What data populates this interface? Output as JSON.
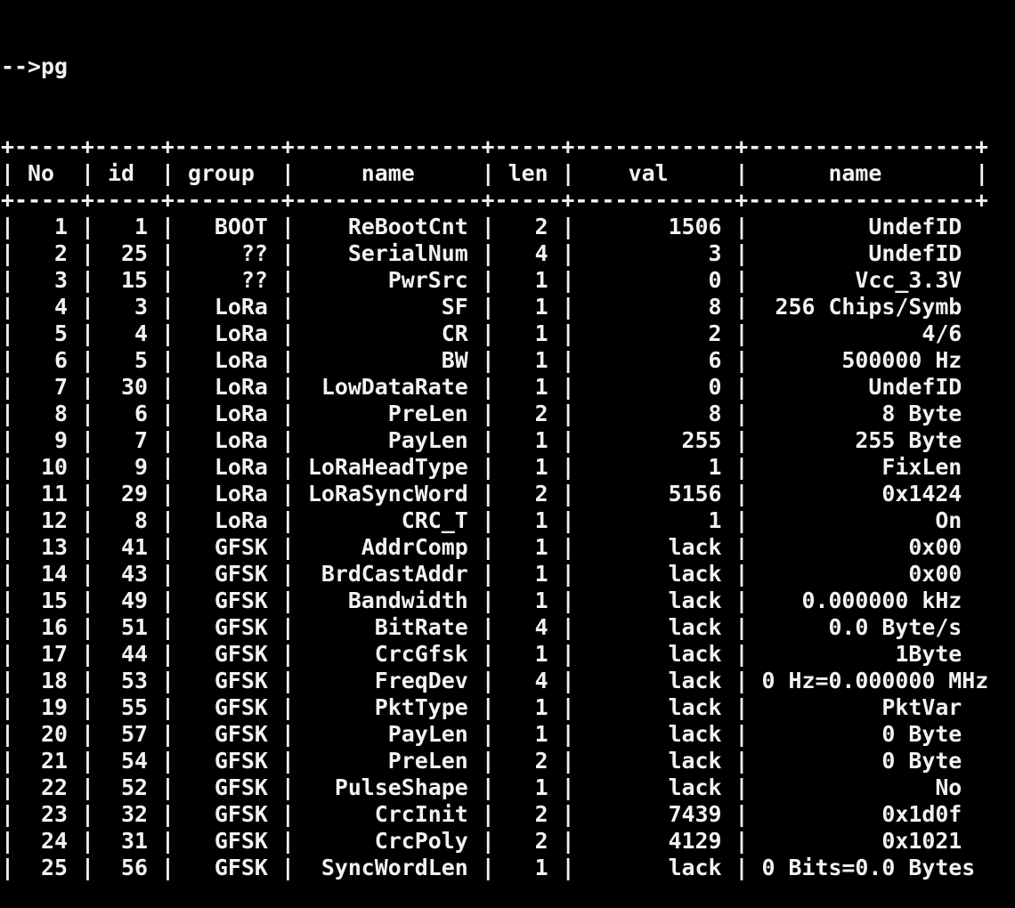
{
  "terminal": {
    "prompt": "-->",
    "command": "pg",
    "background": "#000000",
    "foreground": "#f2f2f2"
  },
  "table": {
    "columns": [
      "No",
      "id",
      "group",
      "name",
      "len",
      "val",
      "name"
    ],
    "rows": [
      [
        "1",
        "1",
        "BOOT",
        "ReBootCnt",
        "2",
        "1506",
        "UndefID"
      ],
      [
        "2",
        "25",
        "??",
        "SerialNum",
        "4",
        "3",
        "UndefID"
      ],
      [
        "3",
        "15",
        "??",
        "PwrSrc",
        "1",
        "0",
        "Vcc_3.3V"
      ],
      [
        "4",
        "3",
        "LoRa",
        "SF",
        "1",
        "8",
        "256 Chips/Symb"
      ],
      [
        "5",
        "4",
        "LoRa",
        "CR",
        "1",
        "2",
        "4/6"
      ],
      [
        "6",
        "5",
        "LoRa",
        "BW",
        "1",
        "6",
        "500000 Hz"
      ],
      [
        "7",
        "30",
        "LoRa",
        "LowDataRate",
        "1",
        "0",
        "UndefID"
      ],
      [
        "8",
        "6",
        "LoRa",
        "PreLen",
        "2",
        "8",
        "8 Byte"
      ],
      [
        "9",
        "7",
        "LoRa",
        "PayLen",
        "1",
        "255",
        "255 Byte"
      ],
      [
        "10",
        "9",
        "LoRa",
        "LoRaHeadType",
        "1",
        "1",
        "FixLen"
      ],
      [
        "11",
        "29",
        "LoRa",
        "LoRaSyncWord",
        "2",
        "5156",
        "0x1424"
      ],
      [
        "12",
        "8",
        "LoRa",
        "CRC_T",
        "1",
        "1",
        "On"
      ],
      [
        "13",
        "41",
        "GFSK",
        "AddrComp",
        "1",
        "lack",
        "0x00"
      ],
      [
        "14",
        "43",
        "GFSK",
        "BrdCastAddr",
        "1",
        "lack",
        "0x00"
      ],
      [
        "15",
        "49",
        "GFSK",
        "Bandwidth",
        "1",
        "lack",
        "0.000000 kHz"
      ],
      [
        "16",
        "51",
        "GFSK",
        "BitRate",
        "4",
        "lack",
        "0.0 Byte/s"
      ],
      [
        "17",
        "44",
        "GFSK",
        "CrcGfsk",
        "1",
        "lack",
        "1Byte"
      ],
      [
        "18",
        "53",
        "GFSK",
        "FreqDev",
        "4",
        "lack",
        "0 Hz=0.000000 MHz"
      ],
      [
        "19",
        "55",
        "GFSK",
        "PktType",
        "1",
        "lack",
        "PktVar"
      ],
      [
        "20",
        "57",
        "GFSK",
        "PayLen",
        "1",
        "lack",
        "0 Byte"
      ],
      [
        "21",
        "54",
        "GFSK",
        "PreLen",
        "2",
        "lack",
        "0 Byte"
      ],
      [
        "22",
        "52",
        "GFSK",
        "PulseShape",
        "1",
        "lack",
        "No"
      ],
      [
        "23",
        "32",
        "GFSK",
        "CrcInit",
        "2",
        "7439",
        "0x1d0f"
      ],
      [
        "24",
        "31",
        "GFSK",
        "CrcPoly",
        "2",
        "4129",
        "0x1021"
      ],
      [
        "25",
        "56",
        "GFSK",
        "SyncWordLen",
        "1",
        "lack",
        "0 Bits=0.0 Bytes"
      ]
    ]
  }
}
